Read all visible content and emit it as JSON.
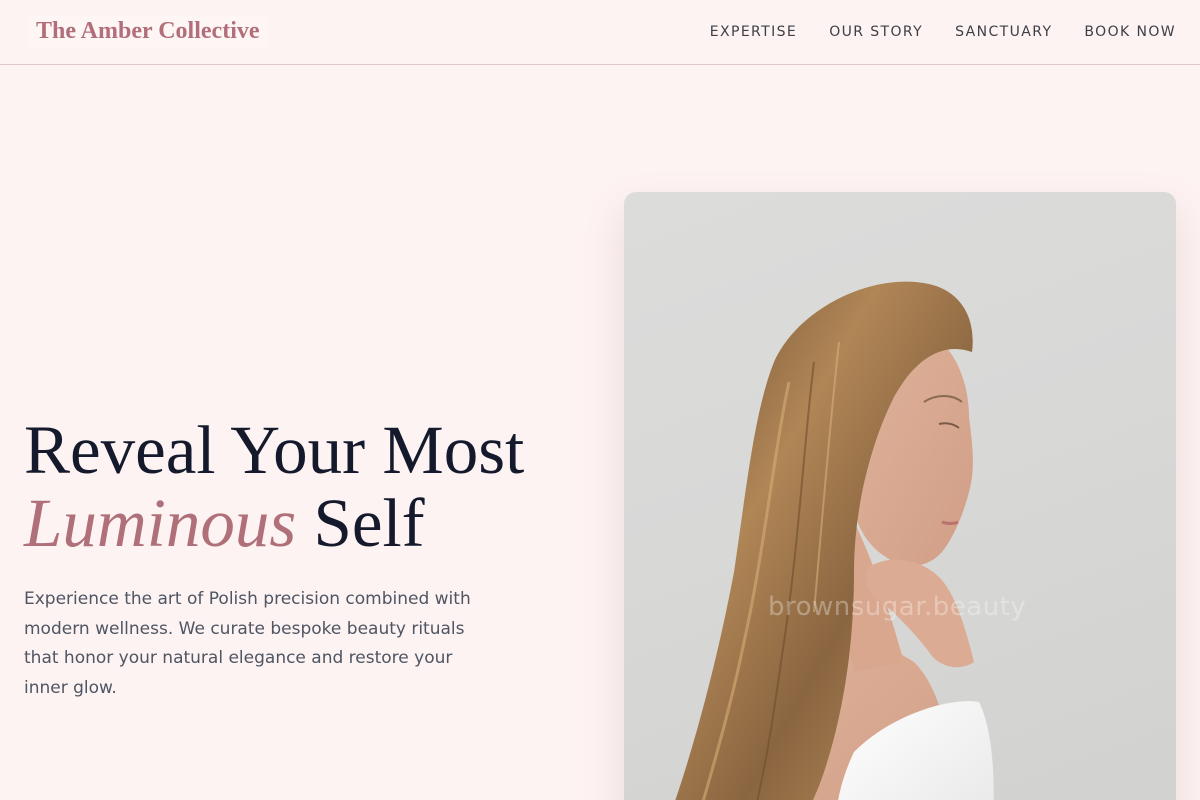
{
  "header": {
    "brand": "The Amber Collective",
    "nav": [
      {
        "label": "EXPERTISE"
      },
      {
        "label": "OUR STORY"
      },
      {
        "label": "SANCTUARY"
      },
      {
        "label": "BOOK NOW"
      }
    ]
  },
  "hero": {
    "title_line1": "Reveal Your Most",
    "title_accent": "Luminous",
    "title_end": "Self",
    "description": "Experience the art of Polish precision combined with modern wellness. We curate bespoke beauty rituals that honor your natural elegance and restore your inner glow.",
    "image": {
      "watermark": "brownsugar.beauty"
    }
  },
  "colors": {
    "background": "#fdf3f2",
    "brand": "#b26e79",
    "accent": "#b0707a",
    "heading": "#141a2c",
    "body_text": "#4e5563",
    "divider": "#e2c5c6"
  }
}
